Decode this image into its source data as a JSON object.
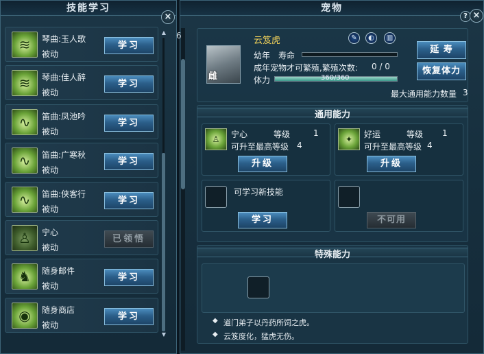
{
  "left_panel": {
    "title": "技能学习",
    "close_label": "×",
    "skills": [
      {
        "name": "琴曲:玉人歌",
        "type": "被动",
        "button": "学习",
        "enabled": true,
        "icon": "zither-icon"
      },
      {
        "name": "琴曲:佳人醉",
        "type": "被动",
        "button": "学习",
        "enabled": true,
        "icon": "zither-icon"
      },
      {
        "name": "笛曲:凤池吟",
        "type": "被动",
        "button": "学习",
        "enabled": true,
        "icon": "flute-icon"
      },
      {
        "name": "笛曲:广寒秋",
        "type": "被动",
        "button": "学习",
        "enabled": true,
        "icon": "flute-icon"
      },
      {
        "name": "笛曲:侠客行",
        "type": "被动",
        "button": "学习",
        "enabled": true,
        "icon": "flute-icon"
      },
      {
        "name": "宁心",
        "type": "被动",
        "button": "已领悟",
        "enabled": false,
        "icon": "meditation-icon"
      },
      {
        "name": "随身邮件",
        "type": "被动",
        "button": "学习",
        "enabled": true,
        "icon": "carriage-icon"
      },
      {
        "name": "随身商店",
        "type": "被动",
        "button": "学习",
        "enabled": true,
        "icon": "shop-icon"
      }
    ]
  },
  "right_panel": {
    "title": "宠物",
    "help_label": "?",
    "close_label": "×",
    "scroll_number": "6",
    "pet": {
      "name": "云笈虎",
      "gender": "雌",
      "stage": "幼年",
      "life_label": "寿命",
      "breed_text": "成年宠物才可繁殖,繁殖次数:",
      "breed_count": "0 / 0",
      "stamina_label": "体力",
      "stamina_value": "360/360",
      "stamina_fraction": 1.0,
      "extend_button": "延 寿",
      "restore_button": "恢复体力",
      "max_ability_text": "最大通用能力数量",
      "max_ability_value": "3"
    },
    "general": {
      "title": "通用能力",
      "abilities": [
        {
          "name": "宁心",
          "level_label": "等级",
          "level": "1",
          "max_text": "可升至最高等级",
          "max_level": "4",
          "button": "升级"
        },
        {
          "name": "好运",
          "level_label": "等级",
          "level": "1",
          "max_text": "可升至最高等级",
          "max_level": "4",
          "button": "升级"
        }
      ],
      "learn_slot": {
        "text": "可学习新技能",
        "button": "学习"
      },
      "unavailable_slot": {
        "button": "不可用"
      }
    },
    "special": {
      "title": "特殊能力",
      "notes": [
        "道门弟子以丹药所饲之虎。",
        "云笈度化，猛虎无伤。"
      ]
    }
  }
}
